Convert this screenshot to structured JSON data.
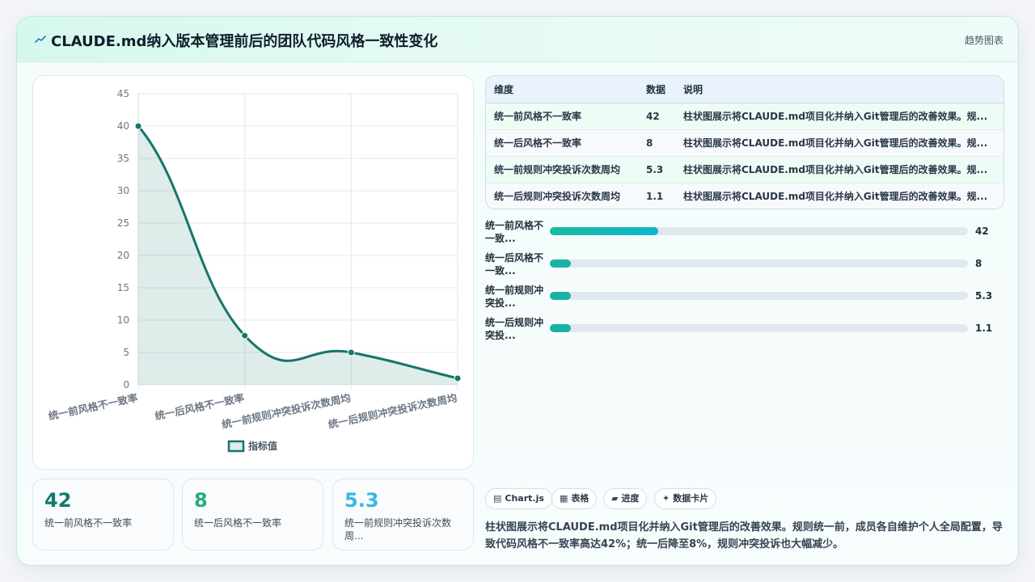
{
  "header": {
    "title": "CLAUDE.md纳入版本管理前后的团队代码风格一致性变化",
    "tag": "趋势图表"
  },
  "chart_data": {
    "type": "line",
    "categories": [
      "统一前风格不一致率",
      "统一后风格不一致率",
      "统一前规则冲突投诉次数周均",
      "统一后规则冲突投诉次数周均"
    ],
    "series": [
      {
        "name": "指标值",
        "values": [
          40,
          7.6,
          5,
          1
        ]
      }
    ],
    "ylim": [
      0,
      45
    ],
    "yticks": [
      "0",
      "5",
      "10",
      "15",
      "20",
      "25",
      "30",
      "35",
      "40",
      "45"
    ],
    "grid": true,
    "legend": "bottom",
    "color": "#17756b"
  },
  "table": {
    "headers": [
      "维度",
      "数据",
      "说明"
    ],
    "rows": [
      [
        "统一前风格不一致率",
        "42",
        "柱状图展示将CLAUDE.md项目化并纳入Git管理后的改善效果。规..."
      ],
      [
        "统一后风格不一致率",
        "8",
        "柱状图展示将CLAUDE.md项目化并纳入Git管理后的改善效果。规..."
      ],
      [
        "统一前规则冲突投诉次数周均",
        "5.3",
        "柱状图展示将CLAUDE.md项目化并纳入Git管理后的改善效果。规..."
      ],
      [
        "统一后规则冲突投诉次数周均",
        "1.1",
        "柱状图展示将CLAUDE.md项目化并纳入Git管理后的改善效果。规..."
      ]
    ]
  },
  "bars": [
    {
      "label": "统一前风格不一致...",
      "value": "42",
      "fraction": 0.26
    },
    {
      "label": "统一后风格不一致...",
      "value": "8",
      "fraction": 0.05
    },
    {
      "label": "统一前规则冲突投...",
      "value": "5.3",
      "fraction": 0.05
    },
    {
      "label": "统一后规则冲突投...",
      "value": "1.1",
      "fraction": 0.05
    }
  ],
  "stats": [
    {
      "value": "42",
      "label": "统一前风格不一致率",
      "color": "#127a6c"
    },
    {
      "value": "8",
      "label": "统一后风格不一致率",
      "color": "#23b07a"
    },
    {
      "value": "5.3",
      "label": "统一前规则冲突投诉次数周...",
      "color": "#3ab6e4"
    }
  ],
  "chips": [
    {
      "icon": "▤",
      "label": "Chart.js"
    },
    {
      "icon": "▦",
      "label": "表格"
    },
    {
      "icon": "▰",
      "label": "进度"
    },
    {
      "icon": "✦",
      "label": "数据卡片"
    }
  ],
  "summary": "柱状图展示将CLAUDE.md项目化并纳入Git管理后的改善效果。规则统一前，成员各自维护个人全局配置，导致代码风格不一致率高达42%；统一后降至8%，规则冲突投诉也大幅减少。",
  "colors": {
    "accent": "#17756b",
    "bar_gradient_start": "#1abc9c",
    "bar_gradient_end": "#0fb5cf"
  }
}
